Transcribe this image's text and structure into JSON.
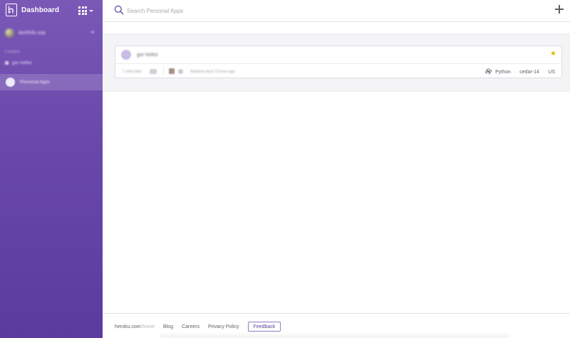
{
  "sidebar": {
    "title": "Dashboard",
    "team_name": "lamftsfa sop",
    "section_label": "Lamgtls",
    "items": [
      {
        "label": "gor heftor"
      }
    ],
    "active_item": {
      "label": "Personal Apps"
    }
  },
  "header": {
    "search_placeholder": "Search Personal Apps"
  },
  "app_card": {
    "name": "gor heftor",
    "meta_time": "1 vhet dels",
    "commit_text": "Relased dust 19 hors ago",
    "stack": [
      "Python",
      "cedar-14",
      "US"
    ]
  },
  "footer": {
    "home_prefix": "heroku.com",
    "home_suffix": "/home",
    "links": [
      "Blog",
      "Careers",
      "Privacy Policy"
    ],
    "feedback_label": "Feedback"
  },
  "colors": {
    "sidebar_top": "#7a58b6",
    "sidebar_bottom": "#5b3b9e",
    "star": "#e2b900",
    "feedback_border": "#8f7cc3"
  },
  "icons": {
    "logo": "heroku-logo-icon",
    "apps_grid": "grid-icon",
    "search": "search-icon",
    "add": "plus-icon",
    "favorite": "star-icon",
    "language": "python-icon"
  }
}
